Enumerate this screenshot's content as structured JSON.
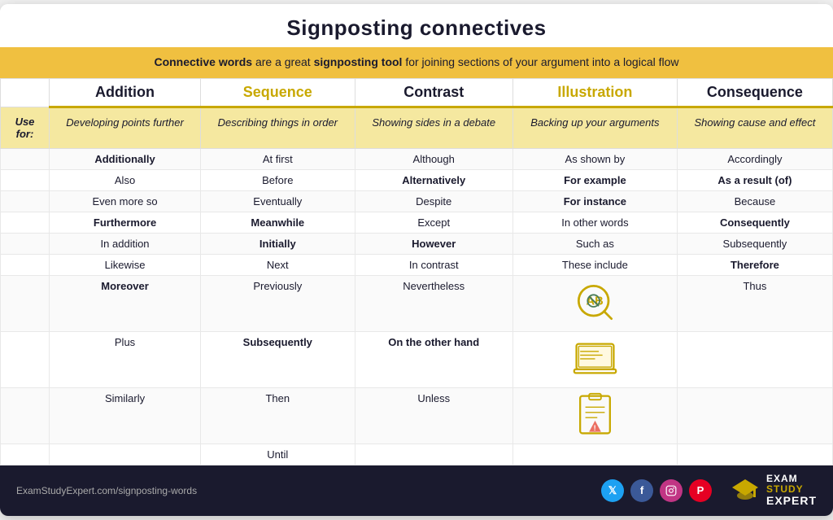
{
  "title": "Signposting connectives",
  "subtitle": {
    "intro": " are a great ",
    "bold1": "Connective words",
    "bold2": "signposting tool",
    "rest": " for joining sections of your argument into a logical flow"
  },
  "use_for_label": "Use for:",
  "columns": [
    {
      "id": "addition",
      "header": "Addition",
      "use_for": "Developing points further",
      "words": [
        {
          "text": "Additionally",
          "bold": true
        },
        {
          "text": "Also",
          "bold": false
        },
        {
          "text": "Even more so",
          "bold": false
        },
        {
          "text": "Furthermore",
          "bold": true
        },
        {
          "text": "In addition",
          "bold": false
        },
        {
          "text": "Likewise",
          "bold": false
        },
        {
          "text": "Moreover",
          "bold": true
        },
        {
          "text": "Plus",
          "bold": false
        },
        {
          "text": "Similarly",
          "bold": false
        }
      ]
    },
    {
      "id": "sequence",
      "header": "Sequence",
      "use_for": "Describing things in order",
      "words": [
        {
          "text": "At first",
          "bold": false
        },
        {
          "text": "Before",
          "bold": false
        },
        {
          "text": "Eventually",
          "bold": false
        },
        {
          "text": "Meanwhile",
          "bold": true
        },
        {
          "text": "Initially",
          "bold": true
        },
        {
          "text": "Next",
          "bold": false
        },
        {
          "text": "Previously",
          "bold": false
        },
        {
          "text": "Subsequently",
          "bold": true
        },
        {
          "text": "Then",
          "bold": false
        },
        {
          "text": "Until",
          "bold": false
        }
      ]
    },
    {
      "id": "contrast",
      "header": "Contrast",
      "use_for": "Showing sides in a debate",
      "words": [
        {
          "text": "Although",
          "bold": false
        },
        {
          "text": "Alternatively",
          "bold": true
        },
        {
          "text": "Despite",
          "bold": false
        },
        {
          "text": "Except",
          "bold": false
        },
        {
          "text": "However",
          "bold": true
        },
        {
          "text": "In contrast",
          "bold": false
        },
        {
          "text": "Nevertheless",
          "bold": false
        },
        {
          "text": "On the other hand",
          "bold": true
        },
        {
          "text": "Unless",
          "bold": false
        }
      ]
    },
    {
      "id": "illustration",
      "header": "Illustration",
      "use_for": "Backing up your arguments",
      "words": [
        {
          "text": "As shown by",
          "bold": false
        },
        {
          "text": "For example",
          "bold": true
        },
        {
          "text": "For instance",
          "bold": true
        },
        {
          "text": "In other words",
          "bold": false
        },
        {
          "text": "Such as",
          "bold": false
        },
        {
          "text": "These include",
          "bold": false
        }
      ],
      "has_icons": true
    },
    {
      "id": "consequence",
      "header": "Consequence",
      "use_for": "Showing cause and effect",
      "words": [
        {
          "text": "Accordingly",
          "bold": false
        },
        {
          "text": "As a result (of)",
          "bold": true
        },
        {
          "text": "Because",
          "bold": false
        },
        {
          "text": "Consequently",
          "bold": true
        },
        {
          "text": "Subsequently",
          "bold": false
        },
        {
          "text": "Therefore",
          "bold": true
        },
        {
          "text": "Thus",
          "bold": false
        }
      ]
    }
  ],
  "footer": {
    "url": "ExamStudyExpert.com/signposting-words",
    "brand": {
      "exam": "EXAM",
      "study": "STUDY",
      "expert": "EXPERT"
    }
  }
}
